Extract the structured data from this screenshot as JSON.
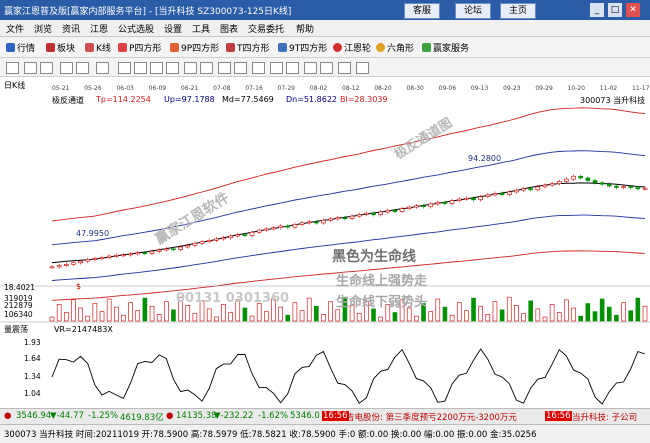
{
  "window": {
    "title": "赢家江恩普及版[赢家内部服务平台] - [当升科技  SZ300073-125日K线]",
    "buttons": {
      "service": "客服",
      "forum": "论坛",
      "home": "主页"
    }
  },
  "menu": [
    "文件",
    "浏览",
    "资讯",
    "江恩",
    "公式选股",
    "设置",
    "工具",
    "图表",
    "交易委托",
    "帮助"
  ],
  "toolbar": [
    "行情",
    "板块",
    "K线",
    "P四方形",
    "9P四方形",
    "T四方形",
    "9T四方形",
    "江恩轮",
    "六角形",
    "赢家服务"
  ],
  "chart": {
    "period_label": "日K线",
    "indicator_name": "极反通道",
    "indicator_values": {
      "tp": "Tp=114.2254",
      "up": "Up=97.1788",
      "md": "Md=77.5469",
      "dn": "Dn=51.8622",
      "bl": "Bl=28.3039"
    },
    "stock_label": "300073 当升科技",
    "date_ticks": [
      "05-21",
      "05-26",
      "06-03",
      "06-09",
      "06-21",
      "07-08",
      "07-16",
      "07-29",
      "08-02",
      "08-12",
      "08-20",
      "08-30",
      "09-06",
      "09-13",
      "09-23",
      "09-29",
      "10-20",
      "11-02",
      "11-17"
    ],
    "high_label": "94.2800",
    "low_label": "47.9950",
    "volume_axis": [
      "18.4021",
      "319019",
      "212879",
      "106340"
    ],
    "volume_marker": "$",
    "osc_name": "量震荡",
    "osc_value": "VR=2147483X",
    "osc_axis": [
      "1.93",
      "1.64",
      "1.34",
      "1.04"
    ]
  },
  "watermarks": {
    "wm1": "极反通道图",
    "wm2": "赢家江恩软件",
    "wm3": "黑色为生命线",
    "wm4": "生命线上强势走",
    "wm5": "生命线下弱势头",
    "wm6": "00131 0301360"
  },
  "stats_bar": {
    "sh_index": "3546.94",
    "sh_change": "▼-44.77",
    "sh_pct": "-1.25%",
    "sh_amount": "4619.83亿",
    "sz_index": "14135.38",
    "sz_change": "▼-232.22",
    "sz_pct": "-1.62%",
    "sz_amount": "5346.0",
    "tag_left": "16:56",
    "news1": "吉电股份: 第三季度预亏2200万元-3200万元",
    "tag_right": "16:56",
    "news2": "当升科技: 子公司"
  },
  "status_line": "300073 当升科技 时间:20211019 开:78.5900 高:78.5979 低:78.5821 收:78.5900 手:0 额:0.00 换:0.00 幅:0.00 振:0.00 金:35.0256",
  "colors": {
    "title_bg": "#2b5ca8",
    "upper_band": "#d02020",
    "mid_band": "#2030a0",
    "life_line": "#000000",
    "candle_up": "#d00000",
    "candle_down": "#009000",
    "watermark_dark": "#707070",
    "watermark_light": "#b8b8b8"
  },
  "price_series": [
    48.2,
    48.9,
    49.5,
    50.3,
    51.1,
    52.0,
    52.4,
    53.0,
    53.7,
    54.1,
    54.3,
    54.8,
    55.4,
    55.0,
    56.1,
    56.8,
    57.4,
    57.0,
    58.3,
    59.1,
    60.2,
    61.0,
    61.7,
    62.4,
    63.0,
    63.9,
    64.6,
    64.2,
    65.8,
    66.9,
    67.5,
    68.1,
    69.0,
    68.4,
    69.8,
    70.6,
    71.1,
    70.5,
    71.9,
    72.6,
    73.2,
    72.8,
    74.0,
    74.9,
    75.5,
    74.7,
    76.1,
    77.0,
    76.3,
    77.8,
    78.6,
    79.3,
    78.8,
    80.2,
    81.0,
    80.4,
    81.9,
    82.7,
    83.1,
    82.3,
    83.9,
    84.8,
    85.6,
    84.9,
    86.3,
    87.2,
    88.0,
    87.4,
    88.9,
    89.8,
    90.5,
    91.7,
    92.8,
    94.28,
    93.4,
    92.1,
    91.0,
    90.2,
    89.3,
    88.6,
    89.0,
    88.5,
    87.9,
    88.2
  ]
}
